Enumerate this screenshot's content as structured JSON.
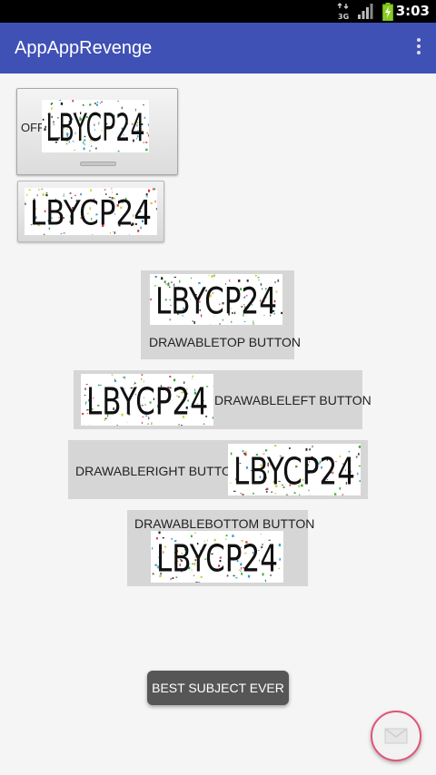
{
  "status_bar": {
    "time": "3:03",
    "data_indicator": "3G",
    "signal_icon": "signal-icon",
    "battery_icon": "battery-charging-icon"
  },
  "app_bar": {
    "title": "AppAppRevenge",
    "overflow_icon": "overflow-menu-icon"
  },
  "captcha_text": "LBYCP24",
  "toggle_button": {
    "label": "OFF"
  },
  "buttons": {
    "drawable_top": "DRAWABLETOP BUTTON",
    "drawable_left": "DRAWABLELEFT BUTTON",
    "drawable_right": "DRAWABLERIGHT BUTTON",
    "drawable_bottom": "DRAWABLEBOTTOM BUTTON"
  },
  "toast": {
    "text": "BEST SUBJECT EVER"
  },
  "fab": {
    "icon": "mail-icon"
  },
  "colors": {
    "app_bar": "#3f51b5",
    "fab_border": "#e0547a",
    "button_bg": "#d6d6d6"
  }
}
